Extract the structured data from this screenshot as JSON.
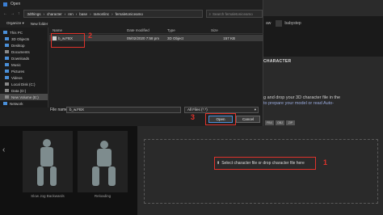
{
  "dialog": {
    "title": "Open",
    "breadcrumb": [
      "3dthings",
      "character",
      "ren",
      "base",
      "ramonlinc",
      "femaletoniceamo"
    ],
    "search_placeholder": "Search femaletoniceamo",
    "toolbar": {
      "organize": "Organize ▾",
      "new_folder": "New folder"
    },
    "nav": [
      {
        "label": "This PC",
        "icon": "pc-icon"
      },
      {
        "label": "3D Objects",
        "icon": "cube-icon"
      },
      {
        "label": "Desktop",
        "icon": "desktop-icon"
      },
      {
        "label": "Documents",
        "icon": "document-icon"
      },
      {
        "label": "Downloads",
        "icon": "download-icon"
      },
      {
        "label": "Music",
        "icon": "music-icon"
      },
      {
        "label": "Pictures",
        "icon": "picture-icon"
      },
      {
        "label": "Videos",
        "icon": "video-icon"
      },
      {
        "label": "Local Disk (C:)",
        "icon": "drive-icon"
      },
      {
        "label": "Data (D:)",
        "icon": "drive-icon"
      },
      {
        "label": "New Volume (E:)",
        "icon": "drive-icon"
      },
      {
        "label": "Network",
        "icon": "network-icon"
      }
    ],
    "columns": {
      "name": "Name",
      "date": "Date modified",
      "type": "Type",
      "size": "Size"
    },
    "files": [
      {
        "name": "b_w.FBX",
        "date": "05/02/2020 7:58 pm",
        "type": "3D Object",
        "size": "157 KB"
      }
    ],
    "file_name_label": "File name:",
    "file_name_value": "b_w.FBX",
    "filter": "All Files (*.*)",
    "open_label": "Open",
    "cancel_label": "Cancel"
  },
  "app": {
    "tabs": [
      "aw",
      "babystep"
    ],
    "panel_title": "CHARACTER",
    "panel_text_1": "g and drop your 3D character file in the",
    "panel_text_2": "to prepare your model or read Auto-",
    "formats": [
      "FBX",
      "OBJ",
      "ZIP"
    ],
    "upload_text": "Select character file or drop character file here"
  },
  "thumbnails": [
    {
      "label": "Slow Jog Backwards"
    },
    {
      "label": "Reloading"
    }
  ],
  "annotations": {
    "one": "1",
    "two": "2",
    "three": "3"
  },
  "colors": {
    "annotation": "#e0332b",
    "accent": "#4a8fd8"
  }
}
